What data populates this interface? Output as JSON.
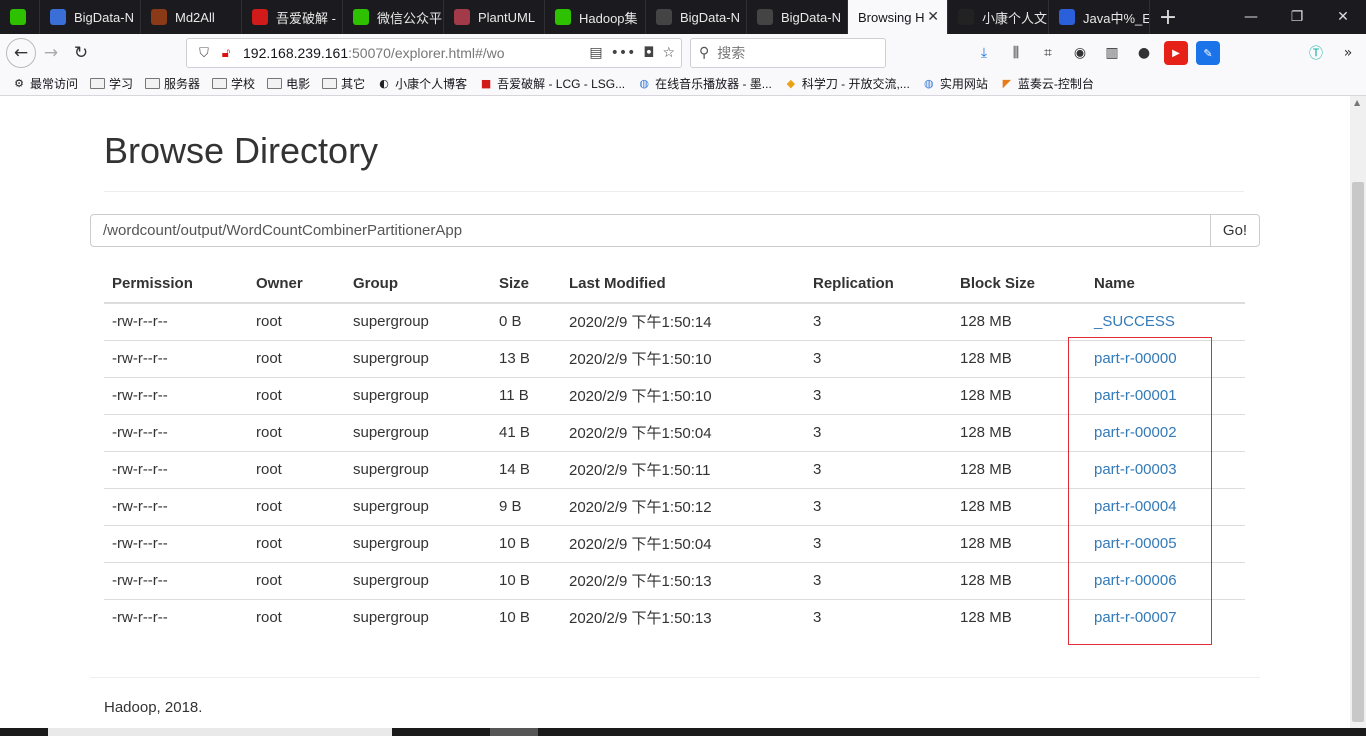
{
  "tabs": [
    {
      "title": "",
      "icon": "wechat-icon",
      "color": "#2dc100"
    },
    {
      "title": "BigData-N",
      "icon": "dot-icon",
      "color": "#3b6fd8"
    },
    {
      "title": "Md2All",
      "icon": "md2all-icon",
      "color": "#8a3a16"
    },
    {
      "title": "吾爱破解 -",
      "icon": "52pojie-icon",
      "color": "#d11b1b"
    },
    {
      "title": "微信公众平",
      "icon": "wechat-icon",
      "color": "#2dc100"
    },
    {
      "title": "PlantUML",
      "icon": "plantuml-icon",
      "color": "#a23a4a"
    },
    {
      "title": "Hadoop集",
      "icon": "wechat-icon",
      "color": "#2dc100"
    },
    {
      "title": "BigData-N",
      "icon": "github-icon",
      "color": "#444444"
    },
    {
      "title": "BigData-N",
      "icon": "github-icon",
      "color": "#444444"
    },
    {
      "title": "Browsing H",
      "icon": "",
      "color": "",
      "active": true
    },
    {
      "title": "小康个人文",
      "icon": "blog-icon",
      "color": "#222222"
    },
    {
      "title": "Java中%_E",
      "icon": "baidu-icon",
      "color": "#2a60d9"
    }
  ],
  "address": {
    "host": "192.168.239.161",
    "rest": ":50070/explorer.html#/wo"
  },
  "search": {
    "placeholder": "搜索"
  },
  "bookmarks": [
    {
      "label": "最常访问",
      "icon": "gear-icon"
    },
    {
      "label": "学习",
      "icon": "folder-icon"
    },
    {
      "label": "服务器",
      "icon": "folder-icon"
    },
    {
      "label": "学校",
      "icon": "folder-icon"
    },
    {
      "label": "电影",
      "icon": "folder-icon"
    },
    {
      "label": "其它",
      "icon": "folder-icon"
    },
    {
      "label": "小康个人博客",
      "icon": "blog-icon"
    },
    {
      "label": "吾爱破解 - LCG - LSG...",
      "icon": "52pojie-icon"
    },
    {
      "label": "在线音乐播放器 - 墨...",
      "icon": "globe-icon"
    },
    {
      "label": "科学刀 - 开放交流,...",
      "icon": "kxd-icon"
    },
    {
      "label": "实用网站",
      "icon": "globe-icon"
    },
    {
      "label": "蓝奏云-控制台",
      "icon": "lanzou-icon"
    }
  ],
  "page": {
    "title": "Browse Directory",
    "path": "/wordcount/output/WordCountCombinerPartitionerApp",
    "go_label": "Go!",
    "footer": "Hadoop, 2018."
  },
  "table": {
    "headers": [
      "Permission",
      "Owner",
      "Group",
      "Size",
      "Last Modified",
      "Replication",
      "Block Size",
      "Name"
    ],
    "rows": [
      [
        "-rw-r--r--",
        "root",
        "supergroup",
        "0 B",
        "2020/2/9 下午1:50:14",
        "3",
        "128 MB",
        "_SUCCESS"
      ],
      [
        "-rw-r--r--",
        "root",
        "supergroup",
        "13 B",
        "2020/2/9 下午1:50:10",
        "3",
        "128 MB",
        "part-r-00000"
      ],
      [
        "-rw-r--r--",
        "root",
        "supergroup",
        "11 B",
        "2020/2/9 下午1:50:10",
        "3",
        "128 MB",
        "part-r-00001"
      ],
      [
        "-rw-r--r--",
        "root",
        "supergroup",
        "41 B",
        "2020/2/9 下午1:50:04",
        "3",
        "128 MB",
        "part-r-00002"
      ],
      [
        "-rw-r--r--",
        "root",
        "supergroup",
        "14 B",
        "2020/2/9 下午1:50:11",
        "3",
        "128 MB",
        "part-r-00003"
      ],
      [
        "-rw-r--r--",
        "root",
        "supergroup",
        "9 B",
        "2020/2/9 下午1:50:12",
        "3",
        "128 MB",
        "part-r-00004"
      ],
      [
        "-rw-r--r--",
        "root",
        "supergroup",
        "10 B",
        "2020/2/9 下午1:50:04",
        "3",
        "128 MB",
        "part-r-00005"
      ],
      [
        "-rw-r--r--",
        "root",
        "supergroup",
        "10 B",
        "2020/2/9 下午1:50:13",
        "3",
        "128 MB",
        "part-r-00006"
      ],
      [
        "-rw-r--r--",
        "root",
        "supergroup",
        "10 B",
        "2020/2/9 下午1:50:13",
        "3",
        "128 MB",
        "part-r-00007"
      ]
    ]
  },
  "colors": {
    "link": "#337ab7",
    "highlight_border": "#e02c38"
  }
}
